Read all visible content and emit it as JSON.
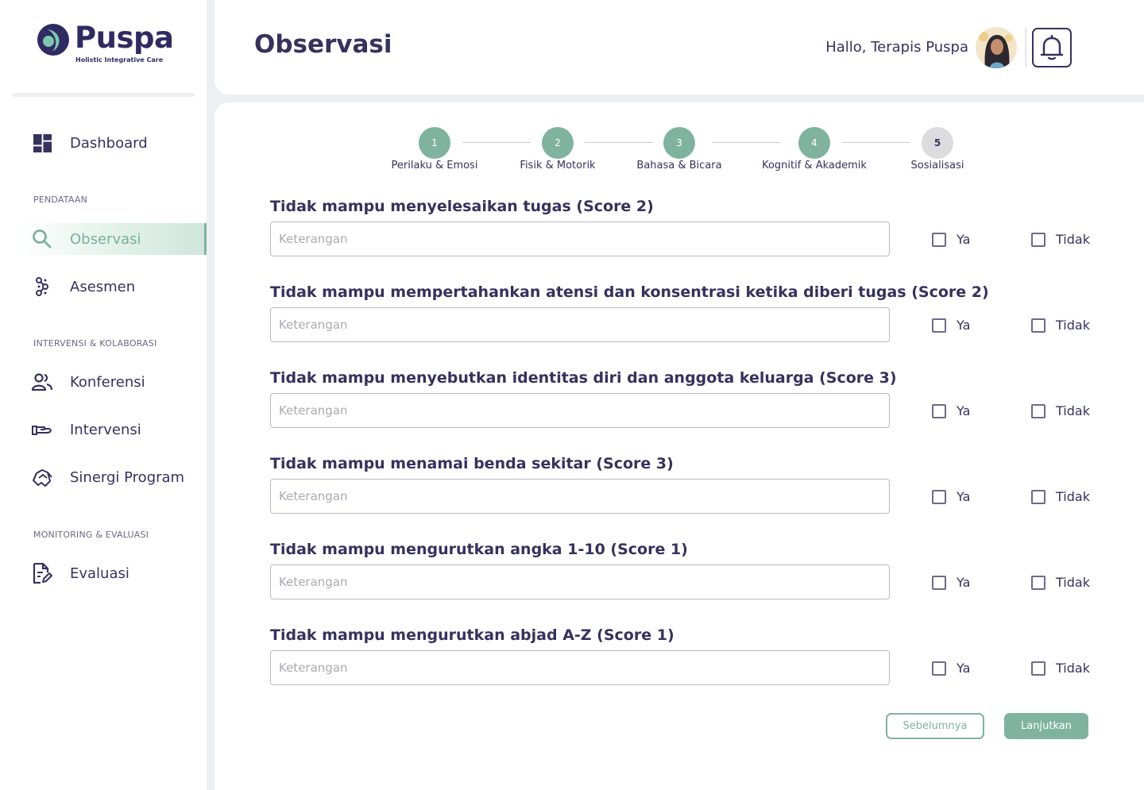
{
  "brand": {
    "name": "Puspa",
    "tagline": "Holistic Integrative Care"
  },
  "sidebar": {
    "dashboard": "Dashboard",
    "sections": [
      {
        "title": "PENDATAAN",
        "items": [
          {
            "label": "Observasi",
            "icon": "search-icon",
            "active": true
          },
          {
            "label": "Asesmen",
            "icon": "dna-icon"
          }
        ]
      },
      {
        "title": "INTERVENSI & KOLABORASI",
        "items": [
          {
            "label": "Konferensi",
            "icon": "users-icon"
          },
          {
            "label": "Intervensi",
            "icon": "hand-icon"
          },
          {
            "label": "Sinergi Program",
            "icon": "handshake-icon"
          }
        ]
      },
      {
        "title": "MONITORING & EVALUASI",
        "items": [
          {
            "label": "Evaluasi",
            "icon": "document-edit-icon"
          }
        ]
      }
    ]
  },
  "header": {
    "title": "Observasi",
    "greeting": "Hallo, Terapis Puspa"
  },
  "stepper": [
    {
      "number": "1",
      "label": "Perilaku & Emosi",
      "done": true
    },
    {
      "number": "2",
      "label": "Fisik & Motorik",
      "done": true
    },
    {
      "number": "3",
      "label": "Bahasa & Bicara",
      "done": true
    },
    {
      "number": "4",
      "label": "Kognitif & Akademik",
      "done": true
    },
    {
      "number": "5",
      "label": "Sosialisasi",
      "done": false
    }
  ],
  "form": {
    "placeholder": "Keterangan",
    "yes_label": "Ya",
    "no_label": "Tidak",
    "questions": [
      "Tidak mampu menyelesaikan tugas (Score 2)",
      "Tidak mampu mempertahankan atensi dan konsentrasi ketika diberi tugas (Score 2)",
      "Tidak mampu menyebutkan identitas diri dan anggota keluarga (Score 3)",
      "Tidak mampu menamai benda sekitar (Score 3)",
      "Tidak mampu mengurutkan angka 1-10 (Score 1)",
      "Tidak mampu mengurutkan abjad A-Z (Score 1)"
    ]
  },
  "actions": {
    "previous": "Sebelumnya",
    "next": "Lanjutkan"
  },
  "colors": {
    "accent": "#7fb3a0",
    "text": "#35325e",
    "background": "#eeeff2"
  }
}
